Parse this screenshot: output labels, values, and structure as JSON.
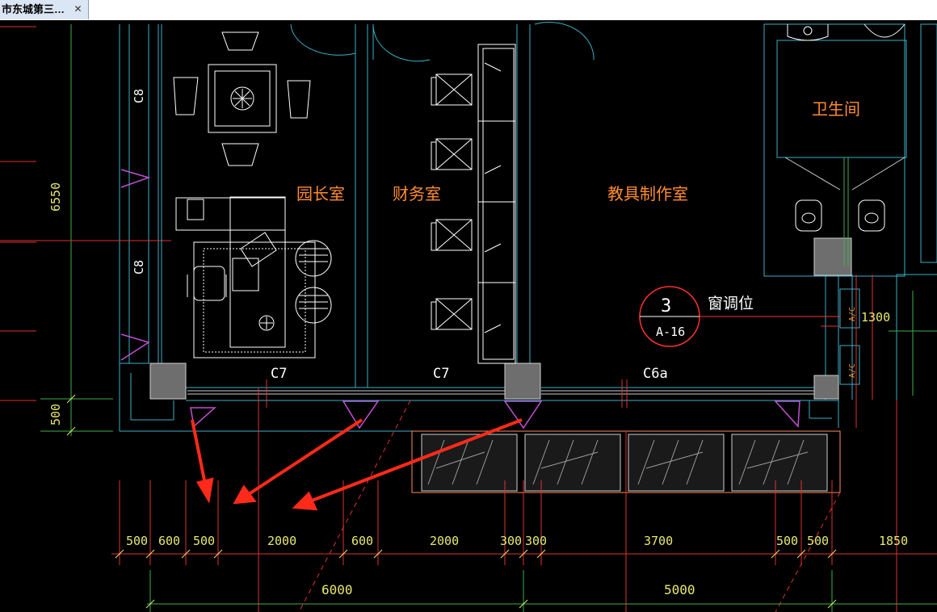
{
  "tab": {
    "title": "市东城第三…",
    "close_glyph": "✕"
  },
  "drawing": {
    "room_labels": {
      "principal": "园长室",
      "finance": "财务室",
      "teaching_aids": "教具制作室",
      "restroom": "卫生间"
    },
    "window_labels": {
      "c7_left": "C7",
      "c7_right": "C7",
      "c6a": "C6a",
      "c8_upper": "C8",
      "c8_lower": "C8"
    },
    "callout": {
      "number": "3",
      "sheet": "A-16",
      "note": "窗调位"
    },
    "left_dimensions": {
      "height": "6550",
      "sill": "500"
    },
    "right_dimension": "1300",
    "duct_tags": [
      "A/C",
      "A/C"
    ],
    "bottom_dimensions": [
      "500",
      "600",
      "500",
      "2000",
      "600",
      "2000",
      "300",
      "300",
      "3700",
      "500",
      "500",
      "1850"
    ],
    "overall_dimensions": [
      "6000",
      "5000"
    ]
  },
  "colors": {
    "background": "#000000",
    "wall": "#3ab0c8",
    "furniture": "#ffffff",
    "room_text": "#ff8c30",
    "dimension": "#e8e870",
    "dim_line": "#ff3030",
    "arrow": "#ff2a1a",
    "column": "#6e6e6e",
    "window_marker": "#c050d0"
  }
}
